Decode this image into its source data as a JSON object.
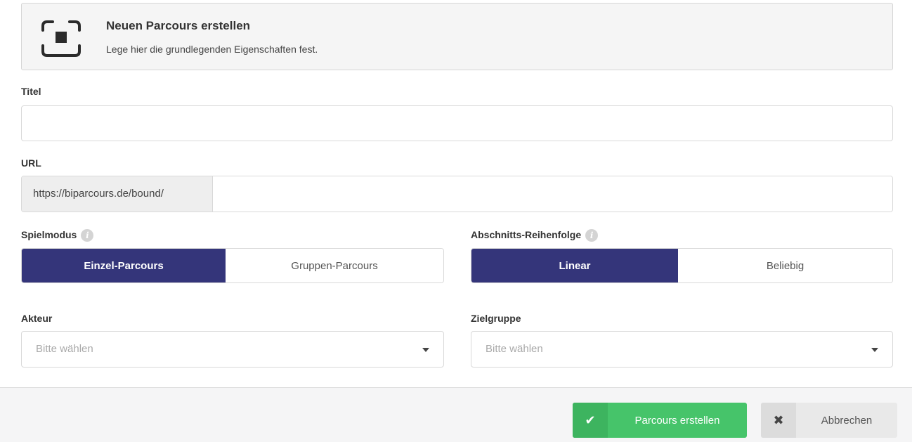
{
  "header": {
    "icon": "focus-frame-icon",
    "title": "Neuen Parcours erstellen",
    "subtitle": "Lege hier die grundlegenden Eigenschaften fest."
  },
  "form": {
    "title": {
      "label": "Titel",
      "value": "",
      "placeholder": ""
    },
    "url": {
      "label": "URL",
      "prefix": "https://biparcours.de/bound/",
      "value": ""
    },
    "spielmodus": {
      "label": "Spielmodus",
      "info_icon": "info-icon",
      "options": [
        "Einzel-Parcours",
        "Gruppen-Parcours"
      ],
      "selected": "Einzel-Parcours"
    },
    "reihenfolge": {
      "label": "Abschnitts-Reihenfolge",
      "info_icon": "info-icon",
      "options": [
        "Linear",
        "Beliebig"
      ],
      "selected": "Linear"
    },
    "akteur": {
      "label": "Akteur",
      "placeholder": "Bitte wählen"
    },
    "zielgruppe": {
      "label": "Zielgruppe",
      "placeholder": "Bitte wählen"
    }
  },
  "footer": {
    "create_label": "Parcours erstellen",
    "create_icon": "check-icon",
    "cancel_label": "Abbrechen",
    "cancel_icon": "close-icon"
  },
  "colors": {
    "active_toggle": "#34357a",
    "primary_button": "#46c46a",
    "secondary_button": "#e9e9e9"
  }
}
